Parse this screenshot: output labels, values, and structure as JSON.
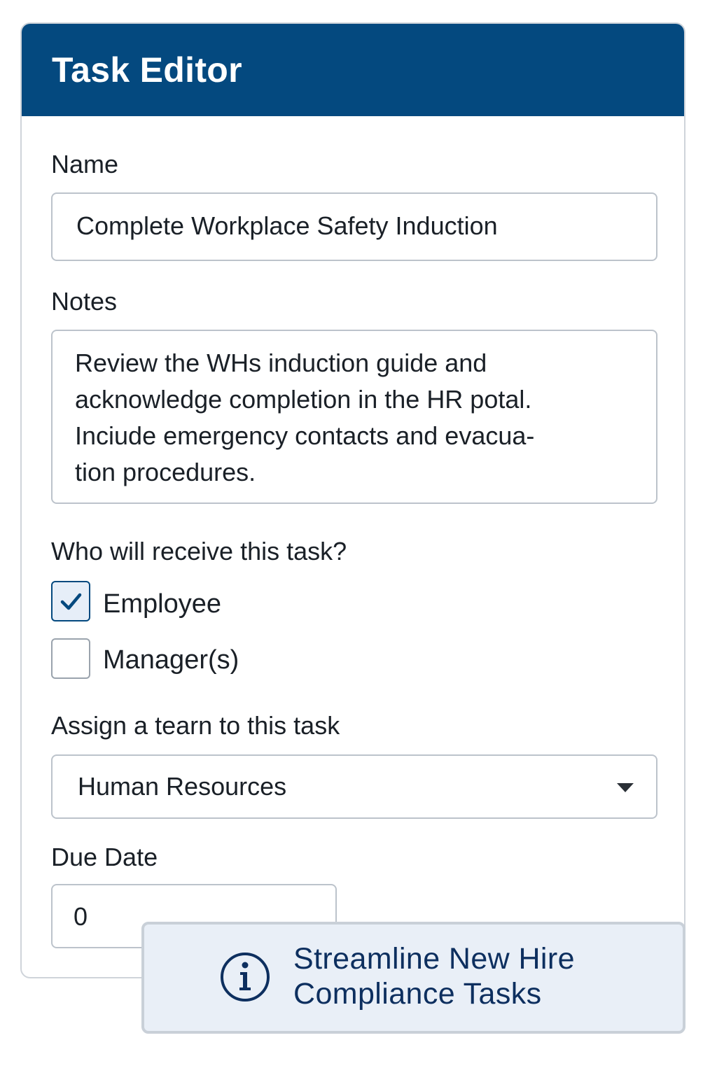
{
  "window": {
    "title": "Task Editor"
  },
  "form": {
    "name_label": "Name",
    "name_value": "Complete Workplace Safety Induction",
    "notes_label": "Notes",
    "notes_value": "Review the WHs induction guide and\nacknowledge completion in the HR potal.\nInciude emergency contacts and evacua-\ntion procedures.",
    "recipients_label": "Who will receive this task?",
    "recipients": [
      {
        "label": "Employee",
        "checked": true
      },
      {
        "label": "Manager(s)",
        "checked": false
      }
    ],
    "team_label": "Assign a tearn to this task",
    "team_value": "Human Resources",
    "due_date_label": "Due Date",
    "due_date_value": "0"
  },
  "banner": {
    "icon": "info-icon",
    "line1": "Streamline New Hire",
    "line2": "Compliance Tasks"
  },
  "colors": {
    "header": "#04497f",
    "banner_text": "#0d2f5f",
    "banner_bg": "#e9eff7"
  }
}
